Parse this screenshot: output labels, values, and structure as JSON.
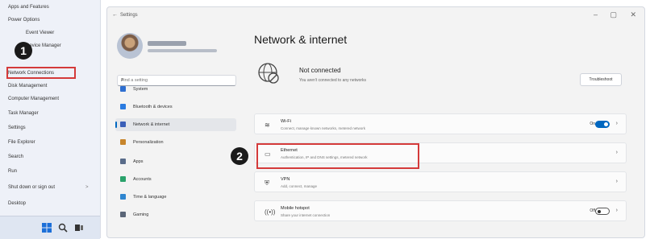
{
  "winx_menu": {
    "items": [
      {
        "label": "Apps and Features",
        "arrow": ""
      },
      {
        "label": "Power Options",
        "arrow": ""
      },
      {
        "label": "Event Viewer",
        "arrow": ""
      },
      {
        "label": "Device Manager",
        "arrow": ""
      },
      {
        "label": "Network Connections",
        "arrow": ""
      },
      {
        "label": "Disk Management",
        "arrow": ""
      },
      {
        "label": "Computer Management",
        "arrow": ""
      },
      {
        "label": "Task Manager",
        "arrow": ""
      },
      {
        "label": "Settings",
        "arrow": ""
      },
      {
        "label": "File Explorer",
        "arrow": ""
      },
      {
        "label": "Search",
        "arrow": ""
      },
      {
        "label": "Run",
        "arrow": ""
      },
      {
        "label": "Shut down or sign out",
        "arrow": ">"
      },
      {
        "label": "Desktop",
        "arrow": ""
      }
    ]
  },
  "badges": {
    "step1": "1",
    "step2": "2"
  },
  "settings": {
    "window_title": "Settings",
    "window_controls": {
      "minimize": "–",
      "maximize": "▢",
      "close": "✕"
    },
    "user": {
      "name": "",
      "email": ""
    },
    "search_placeholder": "Find a setting",
    "nav": [
      {
        "label": "System",
        "icon_color": "#2f6fd0",
        "selected": false
      },
      {
        "label": "Bluetooth & devices",
        "icon_color": "#2a7be0",
        "selected": false
      },
      {
        "label": "Network & internet",
        "icon_color": "#3b5fb8",
        "selected": true
      },
      {
        "label": "Personalization",
        "icon_color": "#c7852b",
        "selected": false
      },
      {
        "label": "Apps",
        "icon_color": "#596c8a",
        "selected": false
      },
      {
        "label": "Accounts",
        "icon_color": "#2aa26b",
        "selected": false
      },
      {
        "label": "Time & language",
        "icon_color": "#2f86d0",
        "selected": false
      },
      {
        "label": "Gaming",
        "icon_color": "#5b6678",
        "selected": false
      }
    ],
    "page_title": "Network & internet",
    "status": {
      "title": "Not connected",
      "subtitle": "You aren't connected to any networks",
      "properties_button": "Troubleshoot"
    },
    "cards": [
      {
        "icon": "wifi-icon",
        "glyph": "≋",
        "title": "Wi-Fi",
        "subtitle": "Connect, manage known networks, metered network",
        "state": "On",
        "toggle": "on",
        "chevron": "›"
      },
      {
        "icon": "ethernet-icon",
        "glyph": "▭",
        "title": "Ethernet",
        "subtitle": "Authentication, IP and DNS settings, metered network",
        "state": "",
        "toggle": "",
        "chevron": "›"
      },
      {
        "icon": "vpn-icon",
        "glyph": "⛨",
        "title": "VPN",
        "subtitle": "Add, connect, manage",
        "state": "",
        "toggle": "",
        "chevron": "›"
      },
      {
        "icon": "mobile-hotspot-icon",
        "glyph": "((•))",
        "title": "Mobile hotspot",
        "subtitle": "Share your internet connection",
        "state": "Off",
        "toggle": "off",
        "chevron": "›"
      }
    ]
  },
  "colors": {
    "accent": "#0067c0",
    "highlight": "#d43a3a"
  }
}
